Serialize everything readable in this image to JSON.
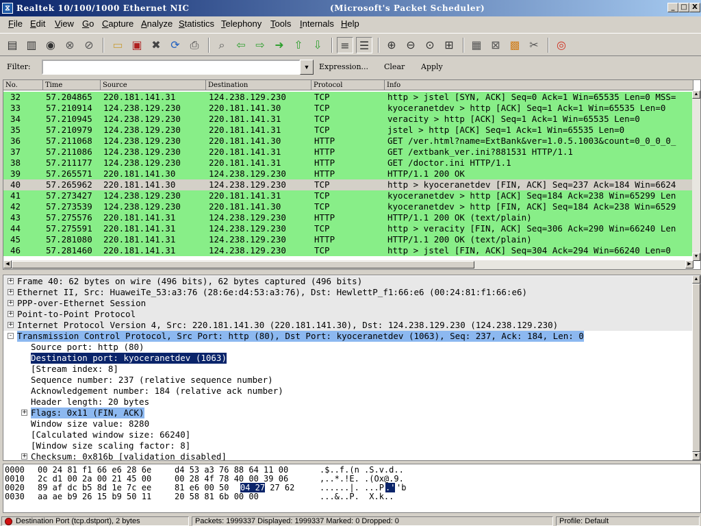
{
  "window": {
    "title_left": "Realtek 10/100/1000 Ethernet NIC",
    "title_center": "(Microsoft's Packet Scheduler)",
    "minimize": "_",
    "maximize": "□",
    "close": "X"
  },
  "menu": [
    "File",
    "Edit",
    "View",
    "Go",
    "Capture",
    "Analyze",
    "Statistics",
    "Telephony",
    "Tools",
    "Internals",
    "Help"
  ],
  "filter": {
    "label": "Filter:",
    "value": "",
    "expression": "Expression...",
    "clear": "Clear",
    "apply": "Apply"
  },
  "columns": [
    "No.",
    "Time",
    "Source",
    "Destination",
    "Protocol",
    "Info"
  ],
  "packets": [
    {
      "no": "32",
      "time": "57.204865",
      "src": "220.181.141.31",
      "dst": "124.238.129.230",
      "proto": "TCP",
      "info": "http > jstel [SYN, ACK] Seq=0 Ack=1 Win=65535 Len=0 MSS="
    },
    {
      "no": "33",
      "time": "57.210914",
      "src": "124.238.129.230",
      "dst": "220.181.141.30",
      "proto": "TCP",
      "info": "kyoceranetdev > http [ACK] Seq=1 Ack=1 Win=65535 Len=0"
    },
    {
      "no": "34",
      "time": "57.210945",
      "src": "124.238.129.230",
      "dst": "220.181.141.31",
      "proto": "TCP",
      "info": "veracity > http [ACK] Seq=1 Ack=1 Win=65535 Len=0"
    },
    {
      "no": "35",
      "time": "57.210979",
      "src": "124.238.129.230",
      "dst": "220.181.141.31",
      "proto": "TCP",
      "info": "jstel > http [ACK] Seq=1 Ack=1 Win=65535 Len=0"
    },
    {
      "no": "36",
      "time": "57.211068",
      "src": "124.238.129.230",
      "dst": "220.181.141.30",
      "proto": "HTTP",
      "info": "GET /ver.html?name=ExtBank&ver=1.0.5.1003&count=0_0_0_0_"
    },
    {
      "no": "37",
      "time": "57.211086",
      "src": "124.238.129.230",
      "dst": "220.181.141.31",
      "proto": "HTTP",
      "info": "GET /extbank_ver.ini?881531 HTTP/1.1"
    },
    {
      "no": "38",
      "time": "57.211177",
      "src": "124.238.129.230",
      "dst": "220.181.141.31",
      "proto": "HTTP",
      "info": "GET /doctor.ini HTTP/1.1"
    },
    {
      "no": "39",
      "time": "57.265571",
      "src": "220.181.141.30",
      "dst": "124.238.129.230",
      "proto": "HTTP",
      "info": "HTTP/1.1 200 OK"
    },
    {
      "no": "40",
      "time": "57.265962",
      "src": "220.181.141.30",
      "dst": "124.238.129.230",
      "proto": "TCP",
      "info": "http > kyoceranetdev [FIN, ACK] Seq=237 Ack=184 Win=6624",
      "selected": true
    },
    {
      "no": "41",
      "time": "57.273427",
      "src": "124.238.129.230",
      "dst": "220.181.141.31",
      "proto": "TCP",
      "info": "kyoceranetdev > http [ACK] Seq=184 Ack=238 Win=65299 Len"
    },
    {
      "no": "42",
      "time": "57.273539",
      "src": "124.238.129.230",
      "dst": "220.181.141.30",
      "proto": "TCP",
      "info": "kyoceranetdev > http [FIN, ACK] Seq=184 Ack=238 Win=6529"
    },
    {
      "no": "43",
      "time": "57.275576",
      "src": "220.181.141.31",
      "dst": "124.238.129.230",
      "proto": "HTTP",
      "info": "HTTP/1.1 200 OK  (text/plain)"
    },
    {
      "no": "44",
      "time": "57.275591",
      "src": "220.181.141.31",
      "dst": "124.238.129.230",
      "proto": "TCP",
      "info": "http > veracity [FIN, ACK] Seq=306 Ack=290 Win=66240 Len"
    },
    {
      "no": "45",
      "time": "57.281080",
      "src": "220.181.141.31",
      "dst": "124.238.129.230",
      "proto": "HTTP",
      "info": "HTTP/1.1 200 OK  (text/plain)"
    },
    {
      "no": "46",
      "time": "57.281460",
      "src": "220.181.141.31",
      "dst": "124.238.129.230",
      "proto": "TCP",
      "info": "http > jstel [FIN, ACK] Seq=304 Ack=294 Win=66240 Len=0"
    }
  ],
  "details": [
    {
      "text": "Frame 40: 62 bytes on wire (496 bits), 62 bytes captured (496 bits)",
      "level": 0,
      "expander": "+",
      "style": "gray"
    },
    {
      "text": "Ethernet II, Src: HuaweiTe_53:a3:76 (28:6e:d4:53:a3:76), Dst: HewlettP_f1:66:e6 (00:24:81:f1:66:e6)",
      "level": 0,
      "expander": "+",
      "style": "gray"
    },
    {
      "text": "PPP-over-Ethernet Session",
      "level": 0,
      "expander": "+",
      "style": "gray"
    },
    {
      "text": "Point-to-Point Protocol",
      "level": 0,
      "expander": "+",
      "style": "gray"
    },
    {
      "text": "Internet Protocol Version 4, Src: 220.181.141.30 (220.181.141.30), Dst: 124.238.129.230 (124.238.129.230)",
      "level": 0,
      "expander": "+",
      "style": "gray"
    },
    {
      "text": "Transmission Control Protocol, Src Port: http (80), Dst Port: kyoceranetdev (1063), Seq: 237, Ack: 184, Len: 0",
      "level": 0,
      "expander": "-",
      "style": "lightblue"
    },
    {
      "text": "Source port: http (80)",
      "level": 1,
      "expander": "",
      "style": ""
    },
    {
      "text": "Destination port: kyoceranetdev (1063)",
      "level": 1,
      "expander": "",
      "style": "darkblue"
    },
    {
      "text": "[Stream index: 8]",
      "level": 1,
      "expander": "",
      "style": ""
    },
    {
      "text": "Sequence number: 237    (relative sequence number)",
      "level": 1,
      "expander": "",
      "style": ""
    },
    {
      "text": "Acknowledgement number: 184    (relative ack number)",
      "level": 1,
      "expander": "",
      "style": ""
    },
    {
      "text": "Header length: 20 bytes",
      "level": 1,
      "expander": "",
      "style": ""
    },
    {
      "text": "Flags: 0x11 (FIN, ACK)",
      "level": 1,
      "expander": "+",
      "style": "lightblue"
    },
    {
      "text": "Window size value: 8280",
      "level": 1,
      "expander": "",
      "style": ""
    },
    {
      "text": "[Calculated window size: 66240]",
      "level": 1,
      "expander": "",
      "style": ""
    },
    {
      "text": "[Window size scaling factor: 8]",
      "level": 1,
      "expander": "",
      "style": ""
    },
    {
      "text": "Checksum: 0x816b [validation disabled]",
      "level": 1,
      "expander": "+",
      "style": ""
    }
  ],
  "hex": [
    {
      "offset": "0000",
      "a": "00 24 81 f1 66 e6 28 6e",
      "b": "d4 53 a3 76 88 64 11 00",
      "ascii": ".$..f.(n .S.v.d.."
    },
    {
      "offset": "0010",
      "a": "2c d1 00 2a 00 21 45 00",
      "b": "00 28 4f 78 40 00 39 06",
      "ascii": ",..*.!E. .(Ox@.9."
    },
    {
      "offset": "0020",
      "a": "89 af dc b5 8d 1e 7c ee",
      "b_pre": "81 e6 00 50 ",
      "b_hl": "04 27",
      "b_post": " 27 62",
      "ascii_pre": "......|. ...P",
      "ascii_hl": ".'",
      "ascii_post": "'b"
    },
    {
      "offset": "0030",
      "a": "aa ae b9 26 15 b9 50 11",
      "b": "20 58 81 6b 00 00",
      "ascii": "...&..P.  X.k.."
    }
  ],
  "status": {
    "field": "Destination Port (tcp.dstport), 2 bytes",
    "packets": "Packets: 1999337 Displayed: 1999337 Marked: 0 Dropped: 0",
    "profile": "Profile: Default"
  }
}
